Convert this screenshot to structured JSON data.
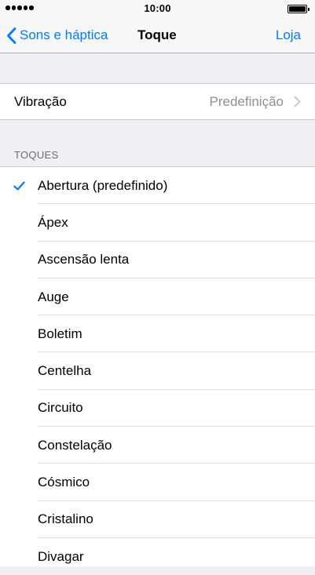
{
  "status_bar": {
    "time": "10:00",
    "signal_icon": "signal-dots-icon",
    "battery_icon": "battery-full-icon"
  },
  "nav": {
    "back_label": "Sons e háptica",
    "back_icon": "chevron-left-icon",
    "title": "Toque",
    "right_label": "Loja"
  },
  "vibration": {
    "label": "Vibração",
    "value": "Predefinição",
    "chevron_icon": "chevron-right-icon"
  },
  "section": {
    "header": "TOQUES"
  },
  "tones": [
    {
      "label": "Abertura (predefinido)",
      "selected": true
    },
    {
      "label": "Ápex",
      "selected": false
    },
    {
      "label": "Ascensão lenta",
      "selected": false
    },
    {
      "label": "Auge",
      "selected": false
    },
    {
      "label": "Boletim",
      "selected": false
    },
    {
      "label": "Centelha",
      "selected": false
    },
    {
      "label": "Circuito",
      "selected": false
    },
    {
      "label": "Constelação",
      "selected": false
    },
    {
      "label": "Cósmico",
      "selected": false
    },
    {
      "label": "Cristalino",
      "selected": false
    },
    {
      "label": "Divagar",
      "selected": false
    }
  ],
  "colors": {
    "accent": "#007aff",
    "background": "#efeff4",
    "secondary_text": "#8e8e93",
    "separator": "#c8c7cc"
  }
}
